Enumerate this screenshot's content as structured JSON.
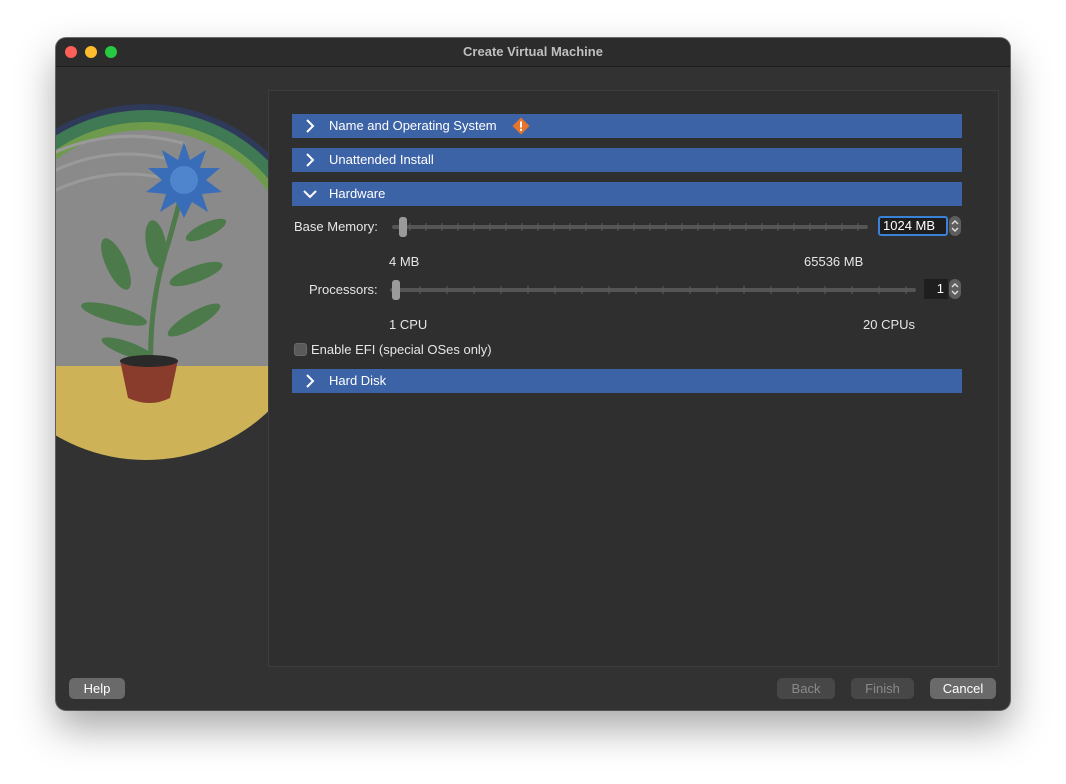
{
  "window": {
    "title": "Create Virtual Machine"
  },
  "sections": {
    "name_os": {
      "label": "Name and Operating System",
      "expanded": false,
      "warning_icon": "warning-icon"
    },
    "unattended": {
      "label": "Unattended Install",
      "expanded": false
    },
    "hardware": {
      "label": "Hardware",
      "expanded": true
    },
    "hard_disk": {
      "label": "Hard Disk",
      "expanded": false
    }
  },
  "hardware": {
    "memory": {
      "label": "Base Memory:",
      "value": "1024 MB",
      "min_label": "4 MB",
      "max_label": "65536 MB",
      "level_fraction": 0.016
    },
    "processors": {
      "label": "Processors:",
      "value": "1",
      "min_label": "1 CPU",
      "max_label": "20 CPUs",
      "level_fraction": 0.0
    },
    "efi": {
      "label": "Enable EFI (special OSes only)",
      "checked": false
    }
  },
  "buttons": {
    "help": "Help",
    "back": "Back",
    "finish": "Finish",
    "cancel": "Cancel"
  },
  "colors": {
    "section_header": "#3c63a6",
    "warning": "#e8742c",
    "focus_ring": "#3a82d8",
    "window_bg": "#323232"
  }
}
